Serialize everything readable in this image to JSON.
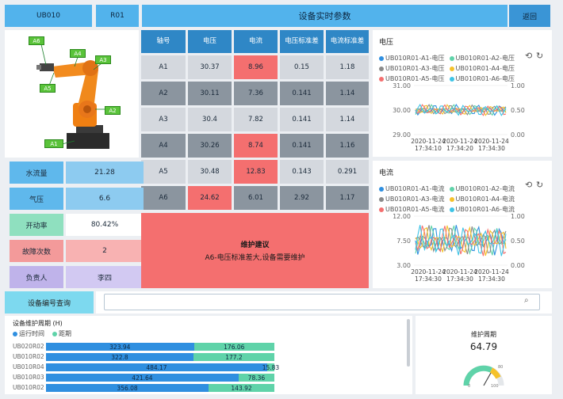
{
  "header": {
    "device_code": "UB010",
    "robot_code": "R01",
    "title": "设备实时参数",
    "back_label": "返回"
  },
  "robot_labels": [
    "A6",
    "A4",
    "A3",
    "A5",
    "A2",
    "A1"
  ],
  "table": {
    "columns": [
      "轴号",
      "电压",
      "电流",
      "电压标准差",
      "电流标准差"
    ],
    "rows": [
      {
        "axis": "A1",
        "voltage": "30.37",
        "current": "8.96",
        "voltage_std": "0.15",
        "current_std": "1.18",
        "highlight": [
          "current"
        ]
      },
      {
        "axis": "A2",
        "voltage": "30.11",
        "current": "7.36",
        "voltage_std": "0.141",
        "current_std": "1.14",
        "highlight": []
      },
      {
        "axis": "A3",
        "voltage": "30.4",
        "current": "7.82",
        "voltage_std": "0.141",
        "current_std": "1.14",
        "highlight": []
      },
      {
        "axis": "A4",
        "voltage": "30.26",
        "current": "8.74",
        "voltage_std": "0.141",
        "current_std": "1.16",
        "highlight": [
          "current"
        ]
      },
      {
        "axis": "A5",
        "voltage": "30.48",
        "current": "12.83",
        "voltage_std": "0.143",
        "current_std": "0.291",
        "highlight": [
          "current"
        ]
      },
      {
        "axis": "A6",
        "voltage": "24.62",
        "current": "6.01",
        "voltage_std": "2.92",
        "current_std": "1.17",
        "highlight": [
          "voltage"
        ]
      }
    ]
  },
  "info": [
    {
      "label": "水流量",
      "value": "21.28"
    },
    {
      "label": "气压",
      "value": "6.6"
    },
    {
      "label": "开动率",
      "value": "80.42%"
    },
    {
      "label": "故障次数",
      "value": "2"
    },
    {
      "label": "负责人",
      "value": "李四"
    }
  ],
  "maintenance": {
    "title": "维护建议",
    "message": "A6-电压标准差大,设备需要维护"
  },
  "search": {
    "label": "设备编号查询",
    "placeholder": ""
  },
  "colors": {
    "header": "#52b3ec",
    "alert": "#f46f6f",
    "run": "#2f8fe0",
    "remain": "#5fd3a9"
  },
  "chart_data": [
    {
      "type": "line",
      "title": "电压",
      "series": [
        {
          "name": "UB010R01-A1-电压",
          "color": "#2f8fe0"
        },
        {
          "name": "UB010R01-A2-电压",
          "color": "#5fd3a9"
        },
        {
          "name": "UB010R01-A3-电压",
          "color": "#8a8a8a"
        },
        {
          "name": "UB010R01-A4-电压",
          "color": "#f5c22b"
        },
        {
          "name": "UB010R01-A5-电压",
          "color": "#f46f6f"
        },
        {
          "name": "UB010R01-A6-电压",
          "color": "#3ec4e6"
        }
      ],
      "y_left_ticks": [
        "29.00",
        "30.00",
        "31.00"
      ],
      "y_right_ticks": [
        "0.00",
        "0.50",
        "1.00"
      ],
      "x_ticks": [
        "2020-11-24 17:34:10",
        "2020-11-24 17:34:20",
        "2020-11-24 17:34:30"
      ],
      "ylim": [
        29,
        31
      ]
    },
    {
      "type": "line",
      "title": "电流",
      "series": [
        {
          "name": "UB010R01-A1-电流",
          "color": "#2f8fe0"
        },
        {
          "name": "UB010R01-A2-电流",
          "color": "#5fd3a9"
        },
        {
          "name": "UB010R01-A3-电流",
          "color": "#8a8a8a"
        },
        {
          "name": "UB010R01-A4-电流",
          "color": "#f5c22b"
        },
        {
          "name": "UB010R01-A5-电流",
          "color": "#f46f6f"
        },
        {
          "name": "UB010R01-A6-电流",
          "color": "#3ec4e6"
        }
      ],
      "y_left_ticks": [
        "3.00",
        "7.50",
        "12.00"
      ],
      "y_right_ticks": [
        "0.00",
        "0.50",
        "1.00"
      ],
      "x_ticks": [
        "2020-11-24 17:34:30",
        "2020-11-24 17:34:30",
        "2020-11-24 17:34:30"
      ],
      "ylim": [
        3,
        12
      ]
    },
    {
      "type": "bar",
      "title": "设备维护周期 (H)",
      "legend": [
        "运行时间",
        "距期"
      ],
      "categories": [
        "UB020R02",
        "UB010R02",
        "UB010R04",
        "UB010R03",
        "UB010R02"
      ],
      "series": [
        {
          "name": "运行时间",
          "values": [
            323.94,
            322.8,
            484.17,
            421.64,
            356.08
          ]
        },
        {
          "name": "距期",
          "values": [
            176.06,
            177.2,
            15.83,
            78.36,
            143.92
          ]
        }
      ]
    }
  ],
  "gauge": {
    "title": "维护周期",
    "value": "64.79",
    "min": "0",
    "max": "100",
    "mark": "80"
  }
}
